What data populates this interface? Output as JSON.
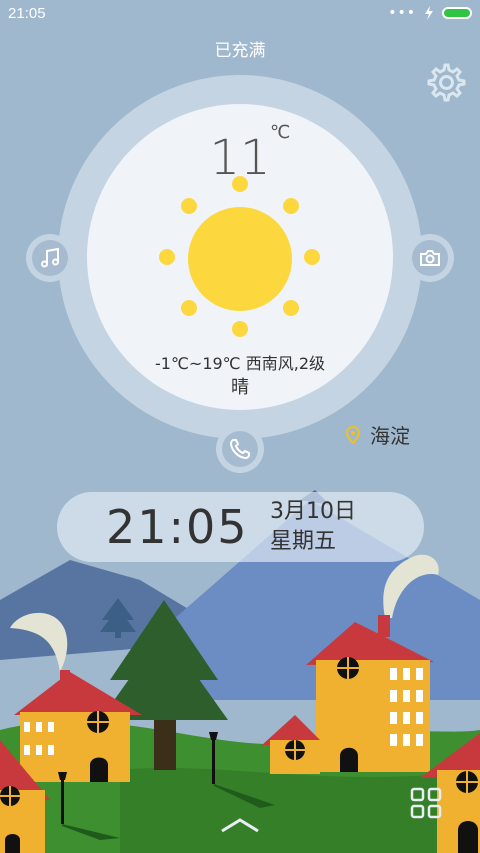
{
  "status": {
    "time": "21:05",
    "dots": "•••",
    "battery_level": 1.0
  },
  "charging_label": "已充满",
  "weather": {
    "temperature": "11",
    "unit": "℃",
    "range_wind": "-1℃~19℃  西南风,2级",
    "condition": "晴",
    "location": "海淀"
  },
  "clock": {
    "time": "21:05",
    "date": "3月10日",
    "weekday": "星期五"
  },
  "colors": {
    "sky": "#9fb8cd",
    "sun": "#fcd83e",
    "grass": "#3e8f2f",
    "house": "#f0b030",
    "roof": "#c8393d"
  },
  "icons": {
    "settings": "gear-icon",
    "music": "music-note-icon",
    "camera": "camera-icon",
    "phone": "phone-icon",
    "location": "location-pin-icon",
    "apps": "apps-grid-icon",
    "unlock": "chevron-up-icon"
  }
}
